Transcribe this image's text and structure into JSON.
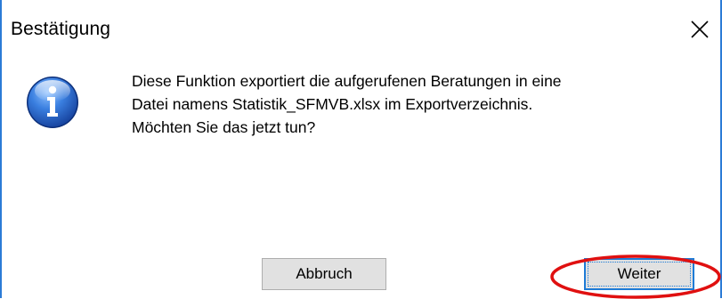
{
  "window": {
    "title": "Bestätigung",
    "close_glyph": "✕"
  },
  "icon": {
    "name": "info-icon",
    "color": "#1f5fbf"
  },
  "message": {
    "lines": [
      "Diese Funktion exportiert die aufgerufenen Beratungen in eine",
      "Datei namens Statistik_SFMVB.xlsx im Exportverzeichnis.",
      "Möchten Sie das jetzt tun?"
    ]
  },
  "buttons": {
    "cancel_label": "Abbruch",
    "continue_label": "Weiter"
  },
  "annotation": {
    "highlight_color": "#e01010"
  }
}
